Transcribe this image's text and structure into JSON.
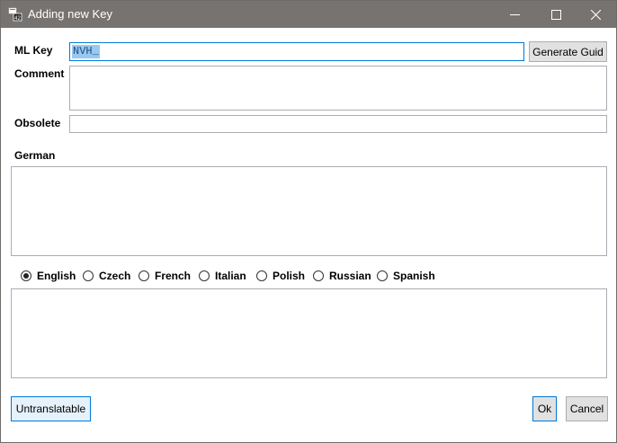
{
  "window": {
    "title": "Adding new Key",
    "icon": "app-resource-icon",
    "title_color": "#777370"
  },
  "form": {
    "ml_key_label": "ML Key",
    "ml_key_value": "NVH_",
    "generate_guid_label": "Generate Guid",
    "comment_label": "Comment",
    "comment_value": "",
    "obsolete_label": "Obsolete",
    "obsolete_value": "",
    "german_label": "German",
    "german_value": "",
    "translation_value": ""
  },
  "languages": [
    {
      "label": "English",
      "selected": true
    },
    {
      "label": "Czech",
      "selected": false
    },
    {
      "label": "French",
      "selected": false
    },
    {
      "label": "Italian",
      "selected": false
    },
    {
      "label": "Polish",
      "selected": false
    },
    {
      "label": "Russian",
      "selected": false
    },
    {
      "label": "Spanish",
      "selected": false
    }
  ],
  "footer": {
    "untranslatable_label": "Untranslatable",
    "ok_label": "Ok",
    "cancel_label": "Cancel"
  },
  "colors": {
    "focus_border": "#0078d7",
    "selection": "#99c9ef"
  }
}
